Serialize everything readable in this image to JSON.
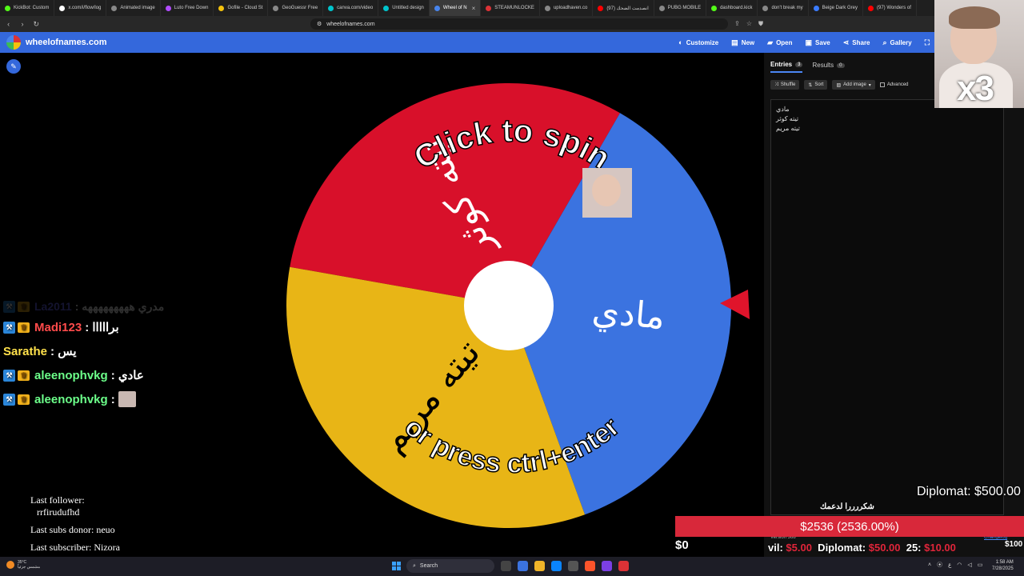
{
  "browser": {
    "tabs": [
      {
        "label": "KickBot: Custom",
        "color": "#53fc18"
      },
      {
        "label": "x.com/i/flow/log",
        "color": "#ffffff"
      },
      {
        "label": "Animated image",
        "color": "#888888"
      },
      {
        "label": "Luto Free Down",
        "color": "#b14cff"
      },
      {
        "label": "Gofile - Cloud St",
        "color": "#f4c20d"
      },
      {
        "label": "GeoGuessr Free",
        "color": "#888888"
      },
      {
        "label": "canva.com/video",
        "color": "#00c4cc"
      },
      {
        "label": "Untitled design",
        "color": "#00c4cc"
      },
      {
        "label": "Wheel of N",
        "color": "#4885ed",
        "active": true
      },
      {
        "label": "STEAMUNLOCKE",
        "color": "#db3236"
      },
      {
        "label": "uploadhaven.co",
        "color": "#888888"
      },
      {
        "label": "(97) انصدمت الضحك",
        "color": "#ff0000"
      },
      {
        "label": "PUBG MOBILE",
        "color": "#888888"
      },
      {
        "label": "dashboard.kick",
        "color": "#53fc18"
      },
      {
        "label": "don't break my",
        "color": "#888888"
      },
      {
        "label": "Beige Dark Grey",
        "color": "#3b7cff"
      },
      {
        "label": "(97) Wonders of",
        "color": "#ff0000"
      }
    ],
    "url": "wheelofnames.com"
  },
  "site": {
    "title": "wheelofnames.com",
    "menu": [
      {
        "label": "Customize",
        "icon": "palette-icon",
        "glyph": "◐"
      },
      {
        "label": "New",
        "icon": "file-icon",
        "glyph": "▤"
      },
      {
        "label": "Open",
        "icon": "folder-icon",
        "glyph": "▰"
      },
      {
        "label": "Save",
        "icon": "save-icon",
        "glyph": "▣"
      },
      {
        "label": "Share",
        "icon": "share-icon",
        "glyph": "⋖"
      },
      {
        "label": "Gallery",
        "icon": "search-icon",
        "glyph": "⌕"
      }
    ]
  },
  "wheel": {
    "prompt_line1": "Click to spin",
    "prompt_line2": "or press ctrl+enter",
    "segments": [
      {
        "label": "تيته كوثر",
        "color": "#d8102a"
      },
      {
        "label": "مادي",
        "color": "#3b73e0"
      },
      {
        "label": "تيته مريم",
        "color": "#e8b516"
      }
    ]
  },
  "panel": {
    "tabs": [
      {
        "label": "Entries",
        "count": "3",
        "active": true
      },
      {
        "label": "Results",
        "count": "0",
        "active": false
      }
    ],
    "tools": {
      "shuffle": "Shuffle",
      "sort": "Sort",
      "add_image": "Add image",
      "advanced": "Advanced"
    },
    "entries": [
      "مادي",
      "تيته كوثر",
      "تيته مريم"
    ],
    "version": "Version 368",
    "changelog": "Changelog"
  },
  "cam": {
    "multiplier": "x3"
  },
  "chat": [
    {
      "user": "La2011",
      "msg": "مدري هههههههههه",
      "color": "#6c6cff",
      "faded": true
    },
    {
      "user": "Madi123",
      "msg": "برااااا",
      "color": "#ff4b4b"
    },
    {
      "user": "Sarathe",
      "msg": "يس",
      "color": "#ffe14b",
      "nobadge": true
    },
    {
      "user": "aleenophvkg",
      "msg": "عادي",
      "color": "#6cff8a"
    },
    {
      "user": "aleenophvkg",
      "msg": "",
      "color": "#6cff8a",
      "emote": true
    }
  ],
  "stream": {
    "last_follower_label": "Last follower:",
    "last_follower": "rrfirudufhd",
    "last_donor": "Last subs donor: neuo",
    "last_subscriber": "Last subscriber: Nizora"
  },
  "donation": {
    "top_right": "Diplomat: $500.00",
    "thanks": "شكررررا لدعمك",
    "goal": "$2536 (2536.00%)",
    "zero": "$0",
    "hundred": "$100",
    "ticker": [
      {
        "text": "vil: ",
        "style": "w"
      },
      {
        "text": "$5.00",
        "style": "r"
      },
      {
        "text": "  Diplomat: ",
        "style": "w"
      },
      {
        "text": "$50.00",
        "style": "r"
      },
      {
        "text": "  25: ",
        "style": "w"
      },
      {
        "text": "$10.00",
        "style": "r"
      }
    ]
  },
  "taskbar": {
    "temp": "35°C",
    "weather": "مشمس جزئياً",
    "search": "Search",
    "time": "1:58 AM",
    "date": "7/28/2025"
  }
}
